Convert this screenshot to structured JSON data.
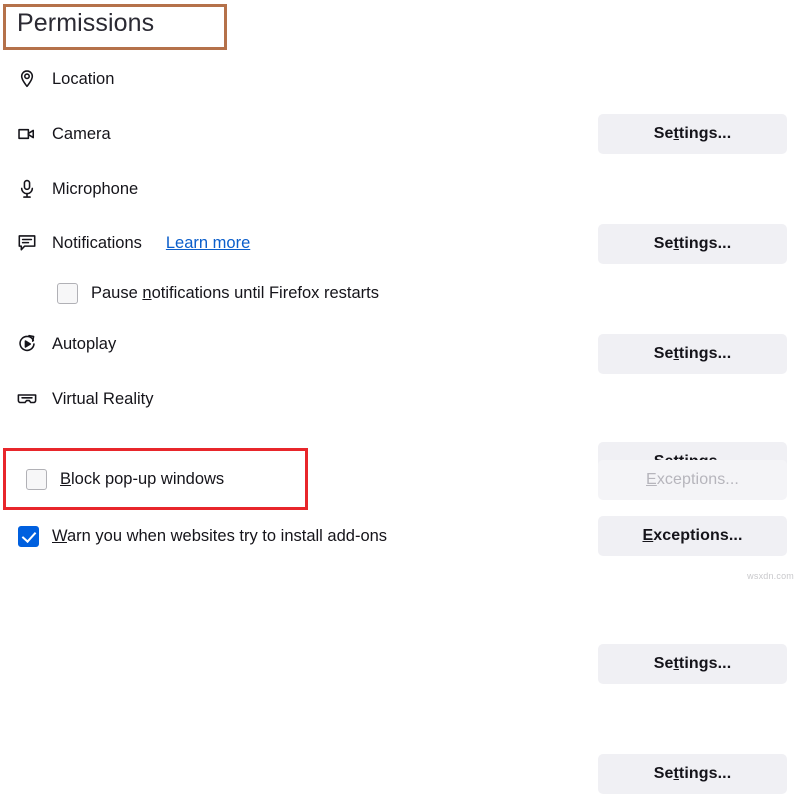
{
  "header": {
    "title": "Permissions",
    "highlight_color": "#b5714a"
  },
  "permissions": [
    {
      "label": "Location",
      "icon": "location-pin-icon",
      "button": {
        "label": "Settings...",
        "accesskey": "t",
        "disabled": false
      }
    },
    {
      "label": "Camera",
      "icon": "camera-icon",
      "button": {
        "label": "Settings...",
        "accesskey": "t",
        "disabled": false
      }
    },
    {
      "label": "Microphone",
      "icon": "microphone-icon",
      "button": {
        "label": "Settings...",
        "accesskey": "t",
        "disabled": false
      }
    },
    {
      "label": "Notifications",
      "icon": "notification-bubble-icon",
      "link": "Learn more",
      "button": {
        "label": "Settings...",
        "accesskey": "t",
        "disabled": false
      }
    },
    {
      "label": "Autoplay",
      "icon": "autoplay-icon",
      "button": {
        "label": "Settings...",
        "accesskey": "t",
        "disabled": false
      }
    },
    {
      "label": "Virtual Reality",
      "icon": "vr-headset-icon",
      "button": {
        "label": "Settings...",
        "accesskey": "t",
        "disabled": false
      }
    }
  ],
  "checkboxes": {
    "pause_notifications": {
      "label_pre": "Pause ",
      "accesskey": "n",
      "label_post": "otifications until Firefox restarts",
      "checked": false
    },
    "block_popups": {
      "label_pre": "",
      "accesskey": "B",
      "label_post": "lock pop-up windows",
      "checked": false,
      "button": {
        "label": "Exceptions...",
        "accesskey": "E",
        "disabled": true
      }
    },
    "warn_addons": {
      "label_pre": "",
      "accesskey": "W",
      "label_post": "arn you when websites try to install add-ons",
      "checked": true,
      "button": {
        "label": "Exceptions...",
        "accesskey": "E",
        "disabled": false
      }
    }
  },
  "highlights": {
    "block_popups_box_color": "#e8262b"
  },
  "watermark": "wsxdn.com"
}
